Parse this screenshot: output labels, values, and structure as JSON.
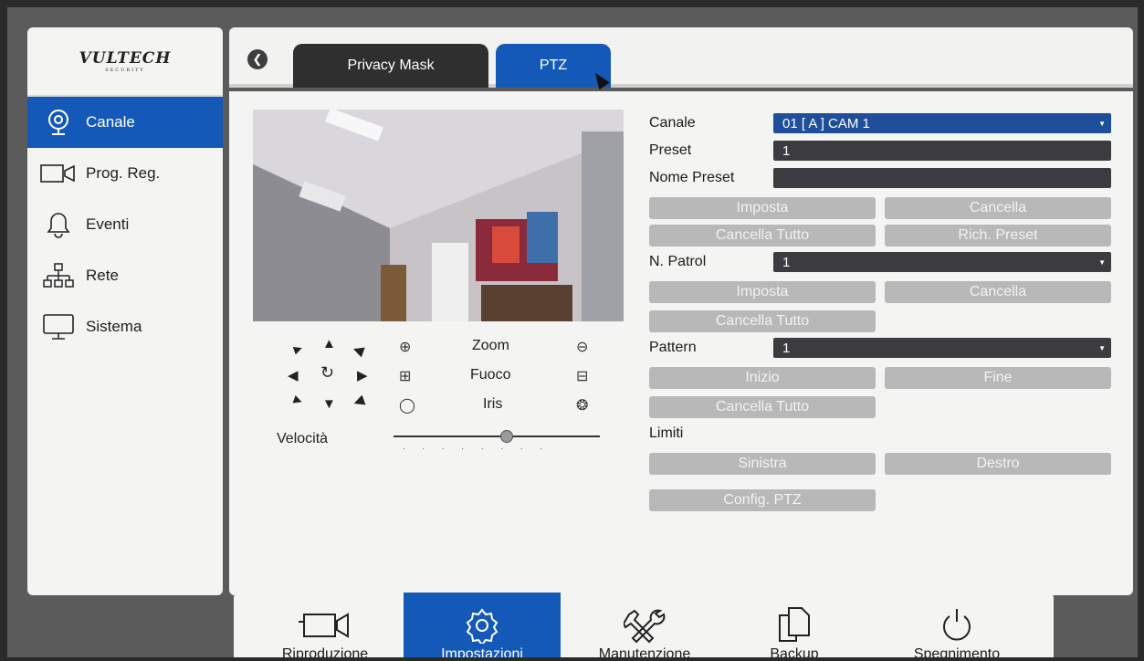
{
  "logo": {
    "brand": "VULTECH",
    "sub": "SECURITY"
  },
  "sidebar": {
    "items": [
      {
        "label": "Canale",
        "icon": "webcam-icon",
        "active": true
      },
      {
        "label": "Prog. Reg.",
        "icon": "video-camera-icon",
        "active": false
      },
      {
        "label": "Eventi",
        "icon": "bell-icon",
        "active": false
      },
      {
        "label": "Rete",
        "icon": "network-icon",
        "active": false
      },
      {
        "label": "Sistema",
        "icon": "monitor-icon",
        "active": false
      }
    ]
  },
  "tabs": [
    {
      "label": "Privacy Mask",
      "active": false
    },
    {
      "label": "PTZ",
      "active": true
    }
  ],
  "ptz": {
    "zoom_label": "Zoom",
    "focus_label": "Fuoco",
    "iris_label": "Iris",
    "speed_label": "Velocità",
    "speed_level": 0.55
  },
  "form": {
    "canale_label": "Canale",
    "canale_value": "01 [ A ] CAM 1",
    "preset_label": "Preset",
    "preset_value": "1",
    "nome_preset_label": "Nome Preset",
    "nome_preset_value": "",
    "preset_imposta": "Imposta",
    "preset_cancella": "Cancella",
    "preset_cancella_tutto": "Cancella Tutto",
    "rich_preset": "Rich. Preset",
    "patrol_label": "N. Patrol",
    "patrol_value": "1",
    "patrol_imposta": "Imposta",
    "patrol_cancella": "Cancella",
    "patrol_cancella_tutto": "Cancella Tutto",
    "pattern_label": "Pattern",
    "pattern_value": "1",
    "pattern_inizio": "Inizio",
    "pattern_fine": "Fine",
    "pattern_cancella_tutto": "Cancella Tutto",
    "limiti_label": "Limiti",
    "sinistra": "Sinistra",
    "destro": "Destro",
    "config_ptz": "Config. PTZ"
  },
  "bottom": {
    "items": [
      {
        "label": "Riproduzione",
        "icon": "video-camera-icon",
        "active": false
      },
      {
        "label": "Impostazioni",
        "icon": "gear-icon",
        "active": true
      },
      {
        "label": "Manutenzione",
        "icon": "tools-icon",
        "active": false
      },
      {
        "label": "Backup",
        "icon": "copy-icon",
        "active": false
      },
      {
        "label": "Spegnimento",
        "icon": "power-icon",
        "active": false
      }
    ]
  },
  "colors": {
    "accent": "#1559b8",
    "field": "#3b3b40",
    "button": "#b8b8b8"
  }
}
